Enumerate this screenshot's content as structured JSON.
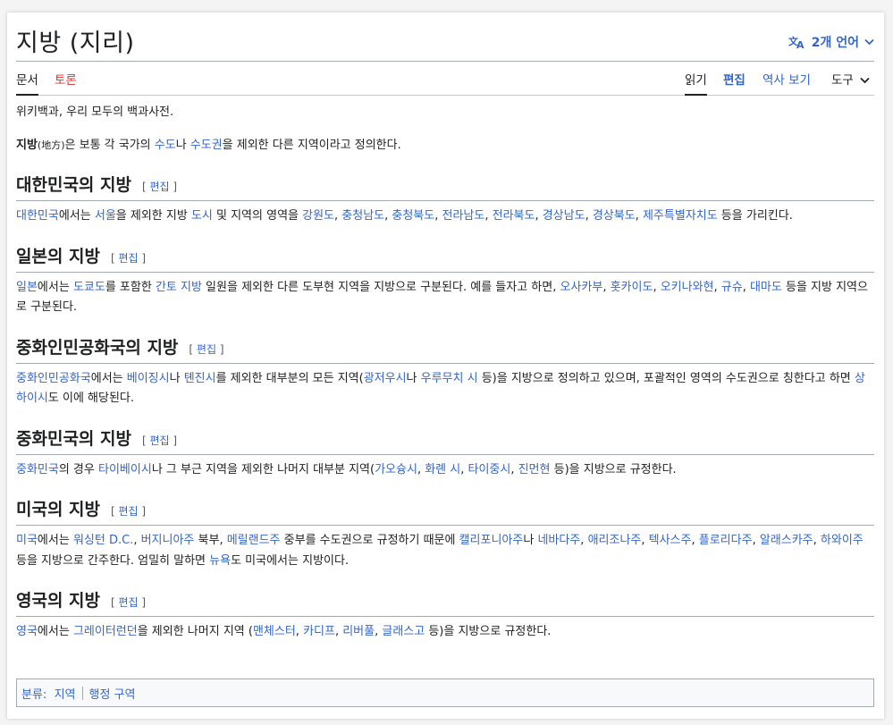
{
  "title": "지방 (지리)",
  "languages": "2개 언어",
  "tabs": {
    "article": "문서",
    "talk": "토론",
    "read": "읽기",
    "edit": "편집",
    "history": "역사 보기",
    "tools": "도구"
  },
  "subtitle": "위키백과, 우리 모두의 백과사전.",
  "edit_label": "편집",
  "intro": {
    "bold": "지방",
    "hanja": "(地方)",
    "t1": "은 보통 각 국가의 ",
    "l1": "수도",
    "t2": "나 ",
    "l2": "수도권",
    "t3": "을 제외한 다른 지역이라고 정의한다."
  },
  "sections": {
    "korea": {
      "heading": "대한민국의 지방",
      "l_country": "대한민국",
      "t1": "에서는 ",
      "l_seoul": "서울",
      "t2": "을 제외한 지방 ",
      "l_city": "도시",
      "t3": " 및 지역의 영역을 ",
      "provinces": [
        "강원도",
        "충청남도",
        "충청북도",
        "전라남도",
        "전라북도",
        "경상남도",
        "경상북도",
        "제주특별자치도"
      ],
      "t4": " 등을 가리킨다."
    },
    "japan": {
      "heading": "일본의 지방",
      "l_country": "일본",
      "t1": "에서는 ",
      "l_tokyo": "도쿄도",
      "t2": "를 포함한 ",
      "l_kanto": "간토 지방",
      "t3": " 일원을 제외한 다른 도부현 지역을 지방으로 구분된다. 예를 들자고 하면, ",
      "regions": [
        "오사카부",
        "홋카이도",
        "오키나와현",
        "규슈",
        "대마도"
      ],
      "t4": " 등을 지방 지역으로 구분된다."
    },
    "prc": {
      "heading": "중화인민공화국의 지방",
      "l_country": "중화인민공화국",
      "t1": "에서는 ",
      "l_beijing": "베이징시",
      "t2": "나 ",
      "l_tianjin": "톈진시",
      "t3": "를 제외한 대부분의 모든 지역(",
      "l_guangzhou": "광저우시",
      "t4": "나 ",
      "l_urumqi": "우루무치 시",
      "t5": " 등)을 지방으로 정의하고 있으며, 포괄적인 영역의 수도권으로 칭한다고 하면 ",
      "l_shanghai": "상하이시",
      "t6": "도 이에 해당된다."
    },
    "roc": {
      "heading": "중화민국의 지방",
      "l_country": "중화민국",
      "t1": "의 경우 ",
      "l_taipei": "타이베이시",
      "t2": "나 그 부근 지역을 제외한 나머지 대부분 지역(",
      "cities": [
        "가오슝시",
        "화롄 시",
        "타이중시",
        "진먼현"
      ],
      "t3": " 등)을 지방으로 규정한다."
    },
    "usa": {
      "heading": "미국의 지방",
      "l_country": "미국",
      "t1": "에서는 ",
      "l_dc": "워싱턴 D.C.",
      "sep1": ", ",
      "l_virginia": "버지니아주",
      "t2": " 북부, ",
      "l_maryland": "메릴랜드주",
      "t3": " 중부를 수도권으로 규정하기 때문에 ",
      "l_california": "캘리포니아주",
      "t4": "나 ",
      "states": [
        "네바다주",
        "애리조나주",
        "텍사스주",
        "플로리다주",
        "알래스카주",
        "하와이주"
      ],
      "t5": " 등을 지방으로 간주한다. 엄밀히 말하면 ",
      "l_newyork": "뉴욕",
      "t6": "도 미국에서는 지방이다."
    },
    "uk": {
      "heading": "영국의 지방",
      "l_country": "영국",
      "t1": "에서는 ",
      "l_london": "그레이터런던",
      "t2": "을 제외한 나머지 지역 (",
      "cities": [
        "맨체스터",
        "카디프",
        "리버풀",
        "글래스고"
      ],
      "t3": " 등)을 지방으로 규정한다."
    }
  },
  "categories": {
    "label": "분류",
    "items": [
      "지역",
      "행정 구역"
    ]
  }
}
